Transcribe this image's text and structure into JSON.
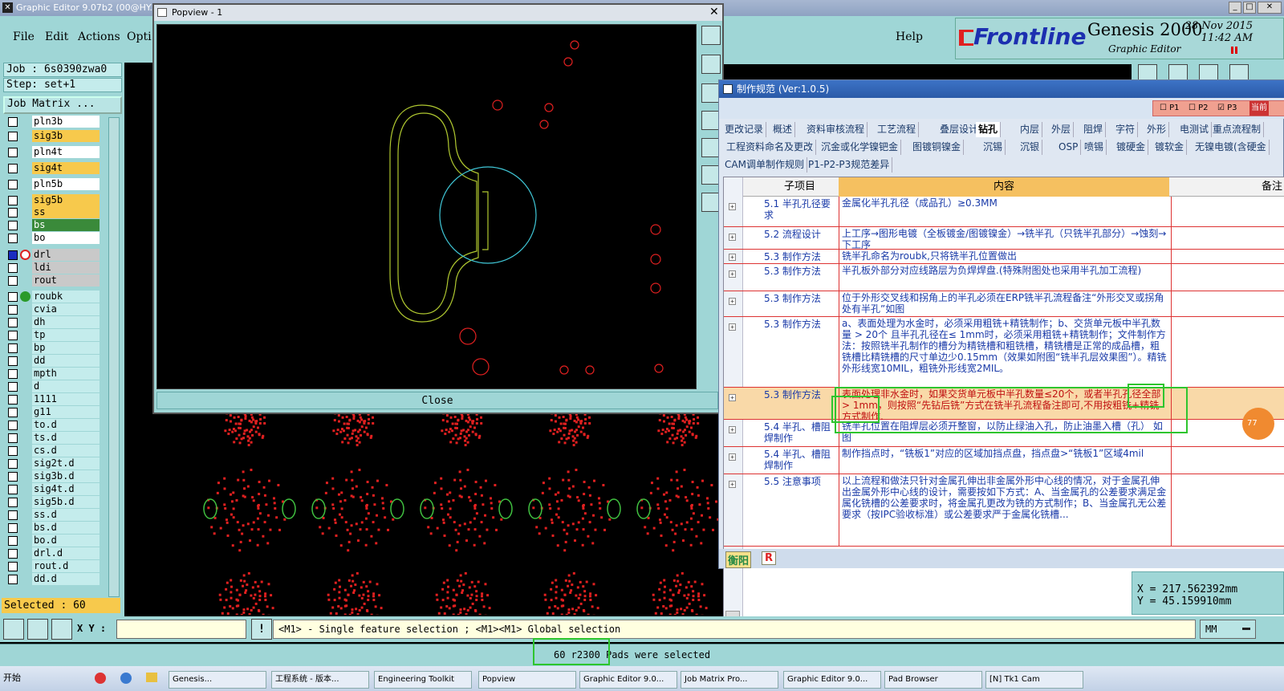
{
  "app": {
    "title": "Graphic Editor 9.07b2 (00@HY...",
    "menus": [
      "File",
      "Edit",
      "Actions",
      "Opti"
    ],
    "help": "Help",
    "brand": "Frontline",
    "product": "Genesis 2000",
    "product_sub": "Graphic Editor",
    "date": "28 Nov 2015",
    "time": "11:42 AM"
  },
  "left": {
    "job": "Job : 6s0390zwa0",
    "step": "Step: set+1",
    "job_matrix": "Job Matrix ...",
    "selected": "Selected : 60",
    "layers": [
      {
        "name": "pln3b",
        "bg": "#ffffff"
      },
      {
        "name": "sig3b",
        "bg": "#f7c94c"
      },
      {
        "name": "pln4t",
        "bg": "#ffffff"
      },
      {
        "name": "sig4t",
        "bg": "#f7c94c"
      },
      {
        "name": "pln5b",
        "bg": "#ffffff"
      },
      {
        "name": "sig5b",
        "bg": "#f7c94c"
      },
      {
        "name": "ss",
        "bg": "#f7c94c"
      },
      {
        "name": "bs",
        "bg": "#3a8a3a"
      },
      {
        "name": "bo",
        "bg": "#ffffff"
      },
      {
        "name": "drl",
        "bg": "#c9c9c9"
      },
      {
        "name": "ldi",
        "bg": "#c9c9c9"
      },
      {
        "name": "rout",
        "bg": "#c9c9c9"
      },
      {
        "name": "roubk",
        "bg": "#c4ecec"
      },
      {
        "name": "cvia",
        "bg": "#c4ecec"
      },
      {
        "name": "dh",
        "bg": "#c4ecec"
      },
      {
        "name": "tp",
        "bg": "#c4ecec"
      },
      {
        "name": "bp",
        "bg": "#c4ecec"
      },
      {
        "name": "dd",
        "bg": "#c4ecec"
      },
      {
        "name": "mpth",
        "bg": "#c4ecec"
      },
      {
        "name": "d",
        "bg": "#c4ecec"
      },
      {
        "name": "1111",
        "bg": "#c4ecec"
      },
      {
        "name": "g11",
        "bg": "#c4ecec"
      },
      {
        "name": "to.d",
        "bg": "#c4ecec"
      },
      {
        "name": "ts.d",
        "bg": "#c4ecec"
      },
      {
        "name": "cs.d",
        "bg": "#c4ecec"
      },
      {
        "name": "sig2t.d",
        "bg": "#c4ecec"
      },
      {
        "name": "sig3b.d",
        "bg": "#c4ecec"
      },
      {
        "name": "sig4t.d",
        "bg": "#c4ecec"
      },
      {
        "name": "sig5b.d",
        "bg": "#c4ecec"
      },
      {
        "name": "ss.d",
        "bg": "#c4ecec"
      },
      {
        "name": "bs.d",
        "bg": "#c4ecec"
      },
      {
        "name": "bo.d",
        "bg": "#c4ecec"
      },
      {
        "name": "drl.d",
        "bg": "#c4ecec"
      },
      {
        "name": "rout.d",
        "bg": "#c4ecec"
      },
      {
        "name": "dd.d",
        "bg": "#c4ecec"
      }
    ]
  },
  "popview": {
    "title": "Popview - 1",
    "close": "Close"
  },
  "spec": {
    "title": "制作规范 (Ver:1.0.5)",
    "checks": [
      "P1",
      "P2",
      "P3",
      "当前"
    ],
    "tabs_row1": [
      "更改记录",
      "概述",
      "资料审核流程",
      "工艺流程",
      "叠层设计",
      "钻孔",
      "内层",
      "外层",
      "阻焊",
      "字符",
      "外形",
      "电测试",
      "重点流程制"
    ],
    "tabs_row2": [
      "工程资料命名及更改",
      "沉金或化学镍钯金",
      "图镀铜镍金",
      "沉锡",
      "沉银",
      "OSP",
      "喷锡",
      "镀硬金",
      "镀软金",
      "无镍电镀(含硬金"
    ],
    "tabs_row3": [
      "CAM调单制作规则",
      "P1-P2-P3规范差异"
    ],
    "col_sub": "子项目",
    "col_content": "内容",
    "col_note": "备注",
    "rows": [
      {
        "sub": "5.1 半孔孔径要求",
        "content": "金属化半孔孔径（成品孔）≥0.3MM"
      },
      {
        "sub": "5.2 流程设计",
        "content": "上工序→图形电镀（全板镀金/图镀镍金）→铣半孔（只铣半孔部分）→蚀刻→下工序"
      },
      {
        "sub": "5.3 制作方法",
        "content": "铣半孔命名为roubk,只将铣半孔位置做出"
      },
      {
        "sub": "5.3 制作方法",
        "content": "半孔板外部分对应线路层为负焊焊盘.(特殊附图处也采用半孔加工流程)"
      },
      {
        "sub": "5.3 制作方法",
        "content": "位于外形交叉线和拐角上的半孔必须在ERP铣半孔流程备注“外形交叉或拐角处有半孔”如图"
      },
      {
        "sub": "5.3 制作方法",
        "content": "a、表面处理为水金时，必须采用粗铣+精铣制作；b、交货单元板中半孔数量 > 20个 且半孔孔径在≤ 1mm时，必须采用粗铣+精铣制作；文件制作方法：按照铣半孔制作的槽分为精铣槽和粗铣槽，精铣槽是正常的成品槽，粗铣槽比精铣槽的尺寸单边少0.15mm（效果如附图“铣半孔层效果图”）。精铣外形线宽10MIL，粗铣外形线宽2MIL。"
      },
      {
        "sub": "5.3 制作方法",
        "content": "表面处理非水金时，如果交货单元板中半孔数量≤20个，或者半孔孔径全部 > 1mm，则按照“先钻后铣”方式在铣半孔流程备注即可,不用按粗铣+精铣方式制作."
      },
      {
        "sub": "5.4 半孔、槽阻焊制作",
        "content": "铣半孔位置在阻焊层必须开整窗，以防止绿油入孔，防止油墨入槽（孔）  如图"
      },
      {
        "sub": "5.4 半孔、槽阻焊制作",
        "content": "制作挡点时，“铣板1”对应的区域加挡点盘，挡点盘>“铣板1”区域4mil"
      },
      {
        "sub": "5.5 注意事项",
        "content": "以上流程和做法只针对金属孔伸出非金属外形中心线的情况，对于金属孔伸出金属外形中心线的设计，需要按如下方式：A、当金属孔的公差要求满足金属化铣槽的公差要求时，将金属孔更改为铣的方式制作；B、当金属孔无公差要求（按IPC验收标准）或公差要求严于金属化铣槽..."
      }
    ],
    "status_left": "衡阳",
    "status_r": "R",
    "badge": "77"
  },
  "coords": {
    "x": "X = 217.562392mm",
    "y": "Y = 45.159910mm"
  },
  "bottom": {
    "xy_label": "X Y :",
    "message": "<M1> - Single feature selection ; <M1><M1> Global selection",
    "units": "MM",
    "status": "60 r2300 Pads were selected"
  },
  "taskbar": {
    "start": "开始",
    "items": [
      "Genesis...",
      "工程系统 - 版本...",
      "Engineering Toolkit",
      "Popview",
      "Graphic Editor 9.0...",
      "Job Matrix Pro...",
      "Graphic Editor 9.0...",
      "Pad Browser",
      "[N] Tk1 Cam"
    ]
  }
}
